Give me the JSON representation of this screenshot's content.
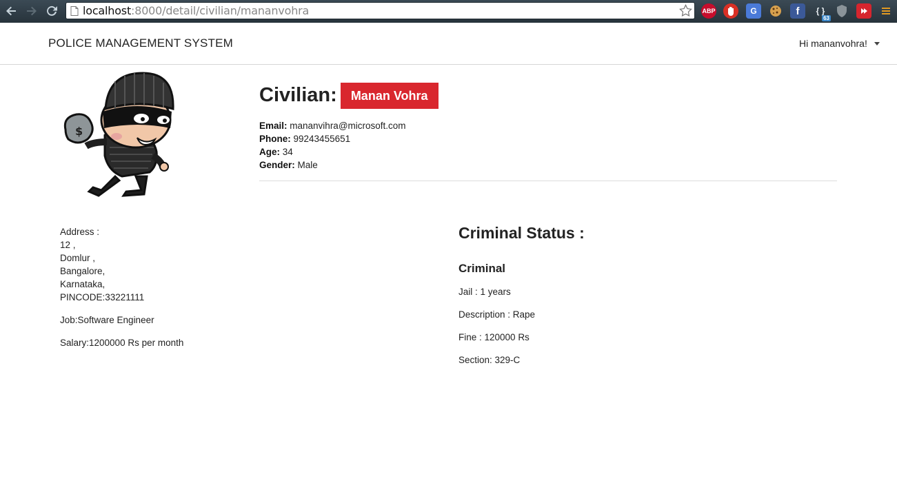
{
  "browser": {
    "url_host": "localhost",
    "url_path": ":8000/detail/civilian/mananvohra",
    "extensions": [
      {
        "name": "adblock-plus-icon",
        "label": "ABP",
        "color": "#c70d2c"
      },
      {
        "name": "stop-icon",
        "label": "",
        "color": "#d93025"
      },
      {
        "name": "translate-icon",
        "label": "G",
        "color": "#4a7ad8"
      },
      {
        "name": "cookie-icon",
        "label": "",
        "color": "#c78d3a"
      },
      {
        "name": "facebook-icon",
        "label": "f",
        "color": "#3b5998"
      },
      {
        "name": "json-icon",
        "label": "{ }",
        "badge": "63",
        "color": "#2b3740"
      },
      {
        "name": "shield-icon",
        "label": "",
        "color": "#8a9399"
      },
      {
        "name": "video-icon",
        "label": "",
        "color": "#d6252e"
      },
      {
        "name": "menu-icon",
        "label": "",
        "color": "#e29a22"
      }
    ]
  },
  "nav": {
    "brand": "POLICE MANAGEMENT SYSTEM",
    "user_greeting": "Hi mananvohra!"
  },
  "profile": {
    "heading_label": "Civilian:",
    "name": "Manan Vohra",
    "email_label": "Email:",
    "email": "mananvihra@microsoft.com",
    "phone_label": "Phone:",
    "phone": "99243455651",
    "age_label": "Age:",
    "age": "34",
    "gender_label": "Gender:",
    "gender": "Male"
  },
  "address": {
    "label": "Address :",
    "line1": "12 ,",
    "line2": "Domlur ,",
    "city": "Bangalore,",
    "state": "Karnataka,",
    "pincode": "PINCODE:33221111"
  },
  "job": "Job:Software Engineer",
  "salary": "Salary:1200000 Rs per month",
  "criminal_status": {
    "heading": "Criminal Status :",
    "status": "Criminal",
    "jail": "Jail : 1 years",
    "description": "Description : Rape",
    "fine": "Fine : 120000 Rs",
    "section": "Section: 329-C"
  },
  "colors": {
    "badge_red": "#d9272e",
    "chrome_dark": "#2e3b44"
  }
}
